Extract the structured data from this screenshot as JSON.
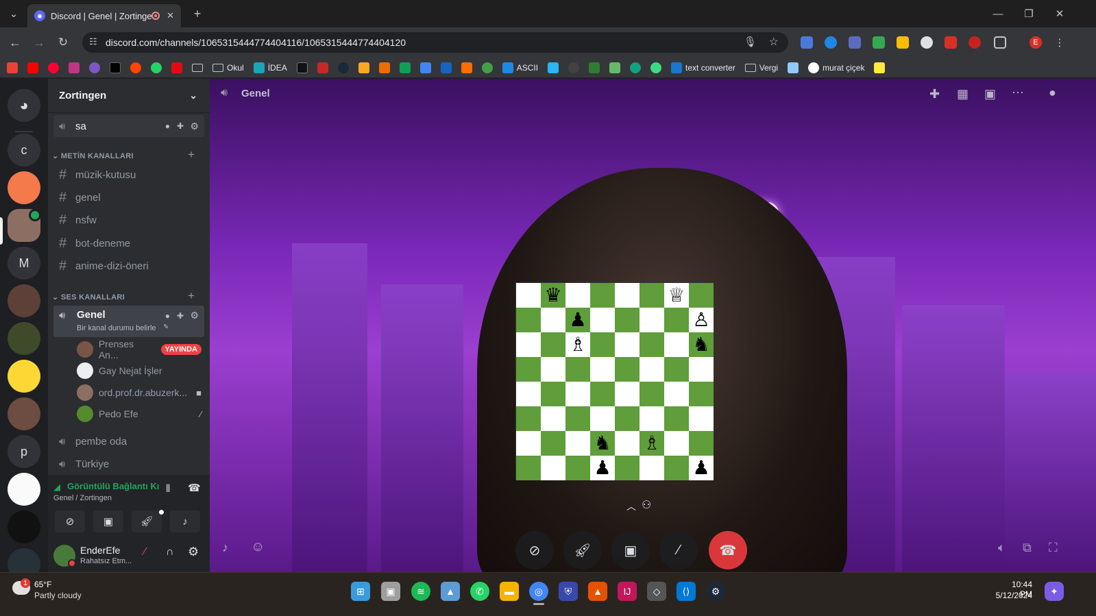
{
  "browser": {
    "tab_title": "Discord | Genel | Zortingen",
    "url": "discord.com/channels/1065315444774404116/1065315444774404120",
    "bookmarks": [
      "Okul",
      "İDEA",
      "ASCII",
      "text converter",
      "Vergi",
      "murat çiçek"
    ],
    "profile_initial": "E"
  },
  "discord": {
    "server_name": "Zortingen",
    "server_letters": [
      "c",
      "M",
      "p"
    ],
    "top_channel": "sa",
    "text_category": "METİN KANALLARI",
    "text_channels": [
      "müzik-kutusu",
      "genel",
      "nsfw",
      "bot-deneme",
      "anime-dizi-öneri"
    ],
    "voice_category": "SES KANALLARI",
    "active_voice": {
      "name": "Genel",
      "status_hint": "Bir kanal durumu belirle"
    },
    "members": [
      {
        "name": "Prenses An...",
        "badge": "YAYINDA"
      },
      {
        "name": "Gay Nejat İşler"
      },
      {
        "name": "ord.prof.dr.abuzerk..."
      },
      {
        "name": "Pedo Efe"
      }
    ],
    "voice_channels_other": [
      "pembe oda",
      "Türkiye"
    ],
    "connection": {
      "title": "Görüntülü Bağlantı Kı",
      "subtitle": "Genel / Zortingen"
    },
    "user": {
      "name": "EnderEfe",
      "status": "Rahatsız Etm..."
    },
    "stage_title": "Genel"
  },
  "chess": {
    "rows": [
      [
        "",
        "♛",
        "",
        "",
        "",
        "",
        "♕",
        ""
      ],
      [
        "",
        "",
        "♟",
        "",
        "",
        "",
        "",
        "♙"
      ],
      [
        "",
        "",
        "♗",
        "",
        "",
        "",
        "",
        "♞"
      ],
      [
        "",
        "",
        "",
        "",
        "",
        "",
        "",
        ""
      ],
      [
        "",
        "",
        "",
        "",
        "",
        "",
        "",
        ""
      ],
      [
        "",
        "",
        "",
        "",
        "",
        "",
        "",
        ""
      ],
      [
        "",
        "",
        "",
        "♞",
        "",
        "♗",
        "",
        ""
      ],
      [
        "",
        "",
        "",
        "♟",
        "",
        "",
        "",
        "♟"
      ]
    ]
  },
  "taskbar": {
    "weather_temp": "65°F",
    "weather_desc": "Partly cloudy",
    "weather_badge": "1",
    "time": "10:44 PM",
    "date": "5/12/2024"
  },
  "colors": {
    "discord_blurple": "#5865f2",
    "live_badge": "#ed4245",
    "voice_connected": "#23a55a",
    "board_dark": "#5f9e3a",
    "board_light": "#ffffff"
  }
}
